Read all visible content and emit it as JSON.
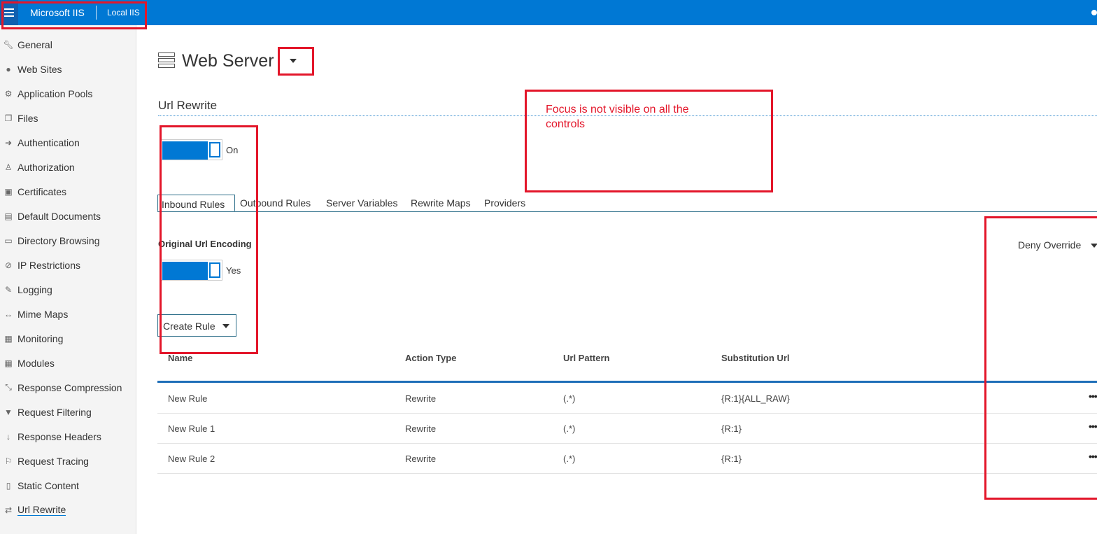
{
  "topbar": {
    "brand": "Microsoft IIS",
    "server": "Local IIS"
  },
  "sidebar": {
    "items": [
      {
        "label": "General",
        "icon": "wrench-icon"
      },
      {
        "label": "Web Sites",
        "icon": "globe-icon"
      },
      {
        "label": "Application Pools",
        "icon": "gears-icon"
      },
      {
        "label": "Files",
        "icon": "files-icon"
      },
      {
        "label": "Authentication",
        "icon": "sign-in-icon"
      },
      {
        "label": "Authorization",
        "icon": "user-icon"
      },
      {
        "label": "Certificates",
        "icon": "lock-icon"
      },
      {
        "label": "Default Documents",
        "icon": "document-icon"
      },
      {
        "label": "Directory Browsing",
        "icon": "folder-icon"
      },
      {
        "label": "IP Restrictions",
        "icon": "ban-icon"
      },
      {
        "label": "Logging",
        "icon": "pencil-icon"
      },
      {
        "label": "Mime Maps",
        "icon": "arrows-horizontal-icon"
      },
      {
        "label": "Monitoring",
        "icon": "briefcase-icon"
      },
      {
        "label": "Modules",
        "icon": "grid-icon"
      },
      {
        "label": "Response Compression",
        "icon": "compress-icon"
      },
      {
        "label": "Request Filtering",
        "icon": "filter-icon"
      },
      {
        "label": "Response Headers",
        "icon": "arrow-down-icon"
      },
      {
        "label": "Request Tracing",
        "icon": "flag-icon"
      },
      {
        "label": "Static Content",
        "icon": "file-icon"
      },
      {
        "label": "Url Rewrite",
        "icon": "exchange-icon",
        "active": true
      }
    ]
  },
  "header": {
    "title": "Web Server"
  },
  "section": {
    "title": "Url Rewrite",
    "enabled_label": "On",
    "tabs": [
      "Inbound Rules",
      "Outbound Rules",
      "Server Variables",
      "Rewrite Maps",
      "Providers"
    ],
    "active_tab": "Inbound Rules",
    "encoding_label": "Original Url Encoding",
    "encoding_value": "Yes",
    "create_rule_label": "Create Rule",
    "deny_override_label": "Deny Override"
  },
  "table": {
    "columns": [
      "Name",
      "Action Type",
      "Url Pattern",
      "Substitution Url"
    ],
    "rows": [
      {
        "name": "New Rule",
        "action": "Rewrite",
        "pattern": "(.*)",
        "substitution": "{R:1}{ALL_RAW}"
      },
      {
        "name": "New Rule 1",
        "action": "Rewrite",
        "pattern": "(.*)",
        "substitution": "{R:1}"
      },
      {
        "name": "New Rule 2",
        "action": "Rewrite",
        "pattern": "(.*)",
        "substitution": "{R:1}"
      }
    ],
    "more_label": "•••"
  },
  "annotation": {
    "text": "Focus is not visible on all the controls",
    "color": "#e3162a"
  },
  "colors": {
    "accent": "#0078d4",
    "annotation": "#e3162a"
  }
}
